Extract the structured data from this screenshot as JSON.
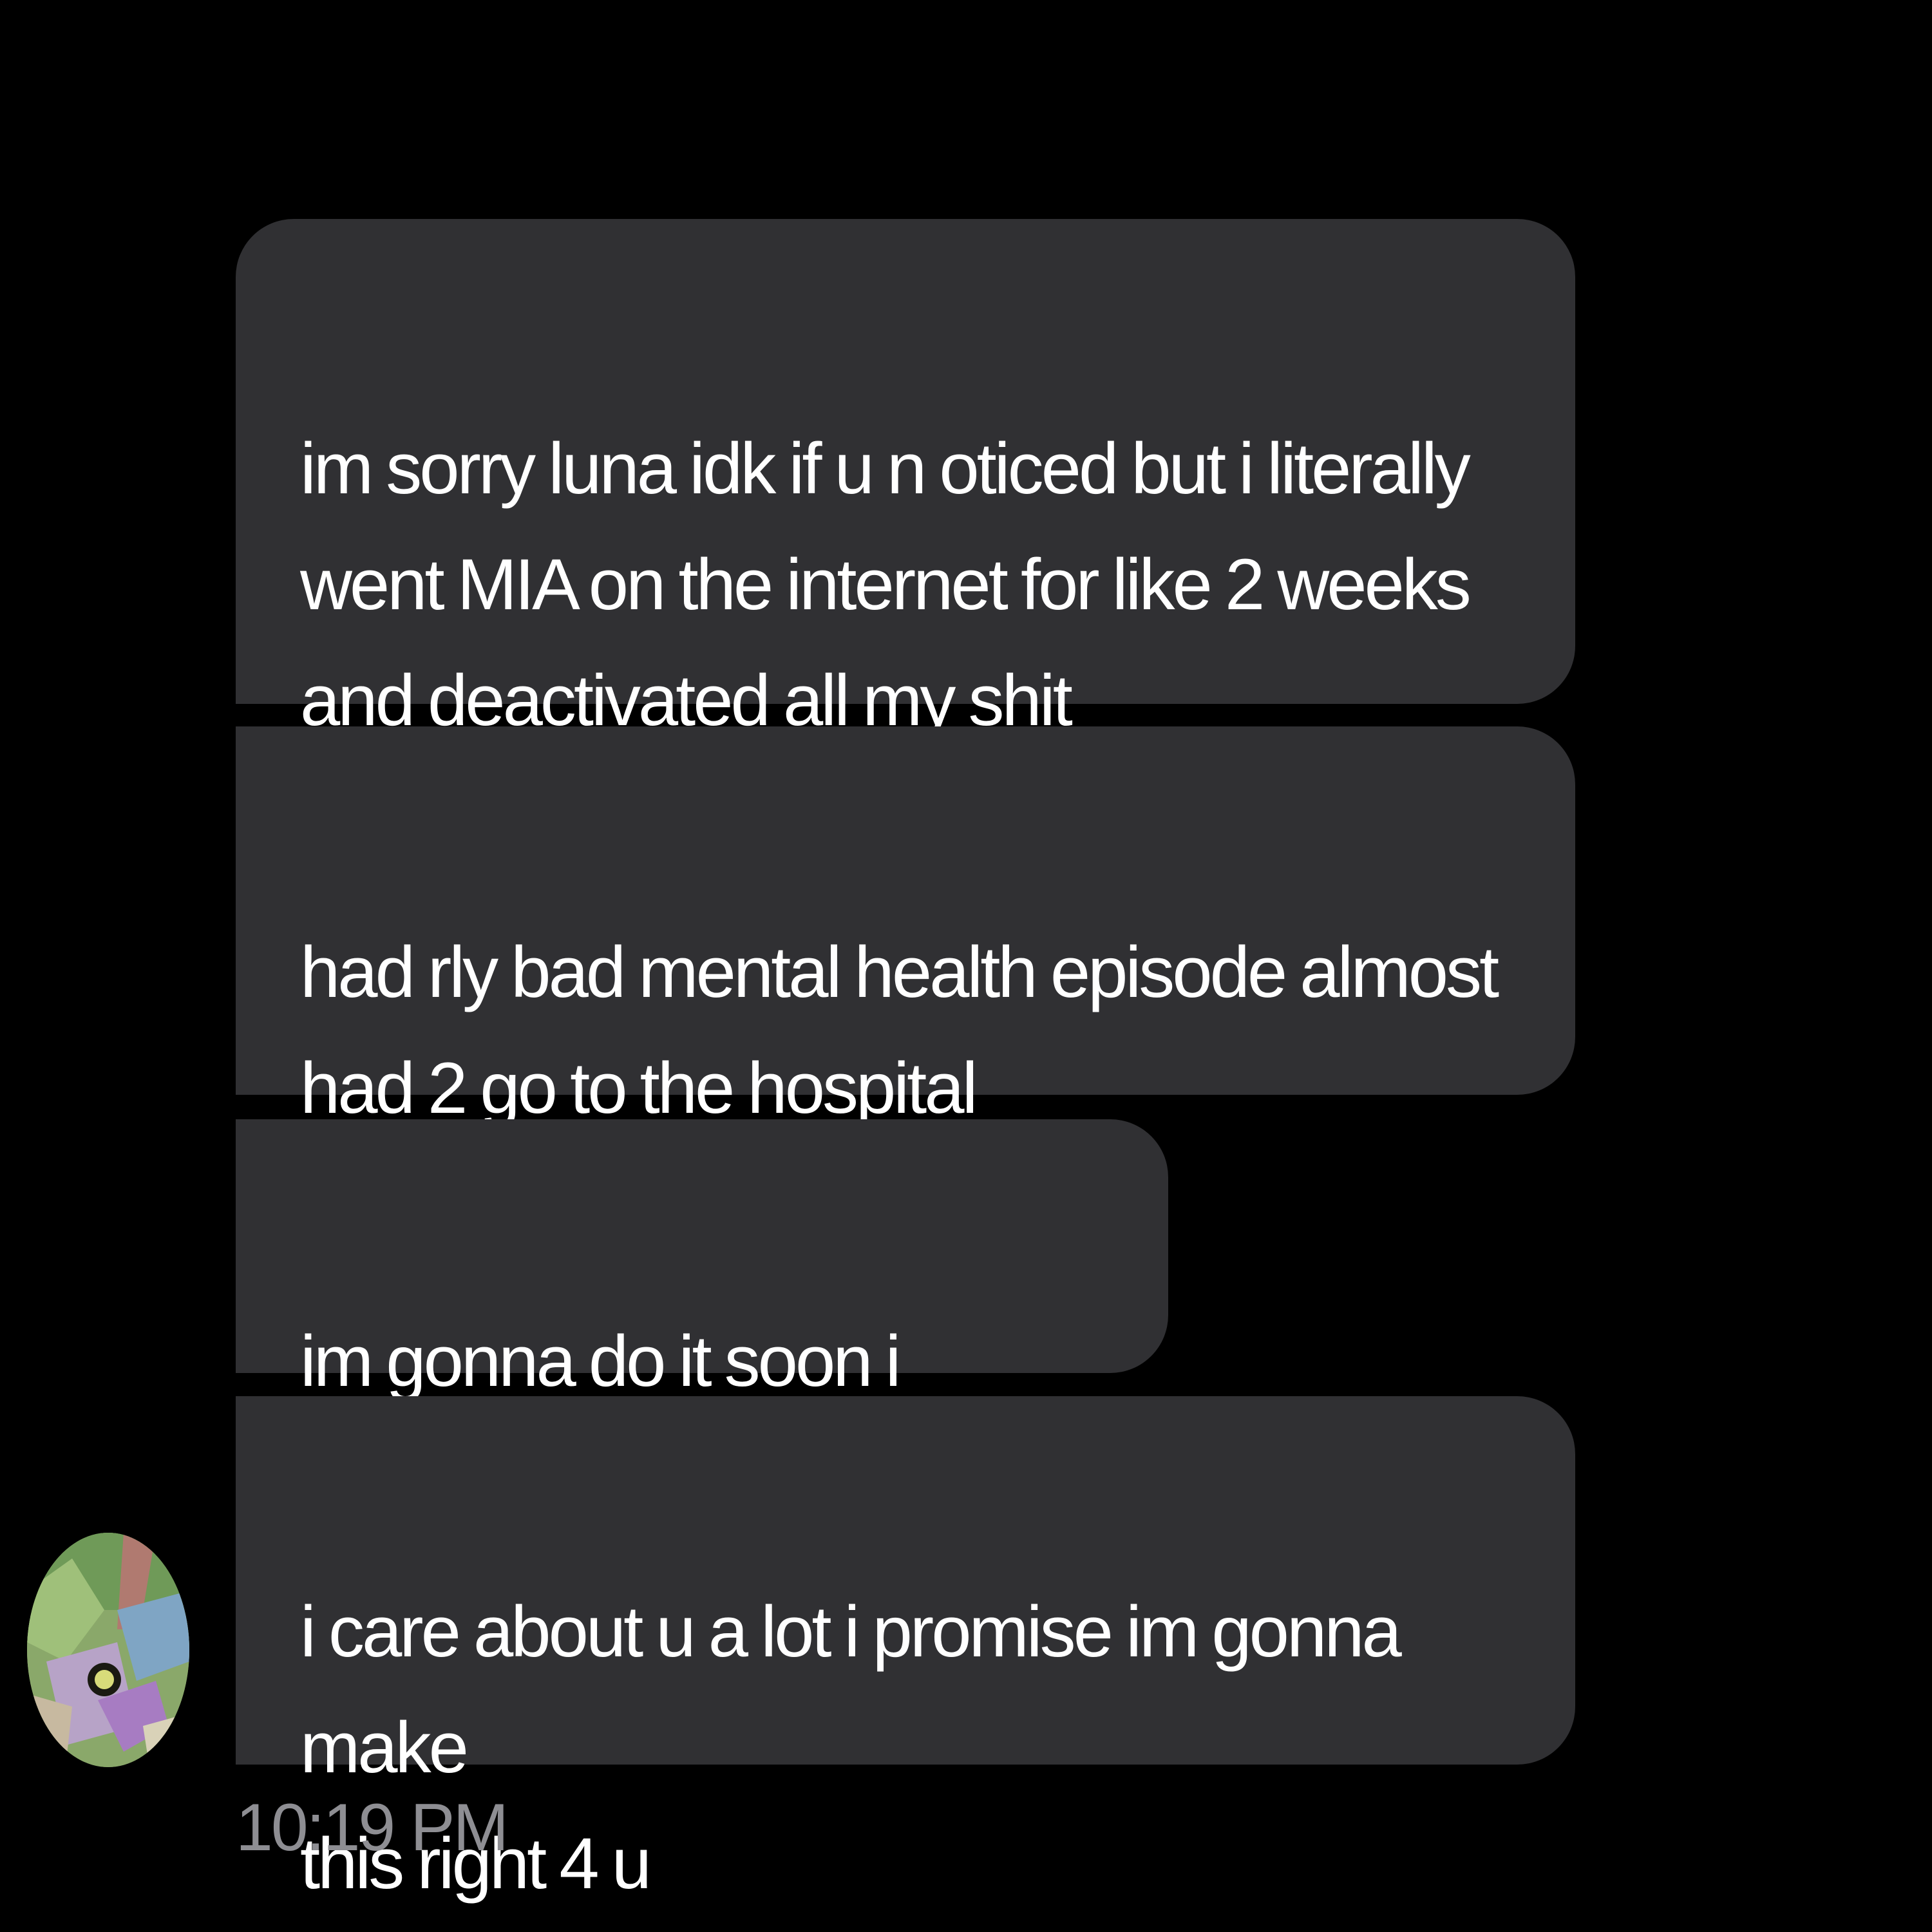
{
  "conversation": {
    "messages": [
      {
        "text": "im sorry luna idk if u n oticed but i literally\nwent MIA on the internet for like 2 weeks\nand deactivated all my shit"
      },
      {
        "text": "had rly bad mental health episode almost\nhad 2 go to the hospital"
      },
      {
        "text": "im gonna do it soon i promise"
      },
      {
        "text": "i care about u a lot i promise im gonna make\nthis right 4 u"
      }
    ],
    "timestamp": "10:19 PM"
  },
  "colors": {
    "background": "#000000",
    "bubble": "#303033",
    "message_text": "#ffffff",
    "timestamp_text": "#8e8e93"
  }
}
